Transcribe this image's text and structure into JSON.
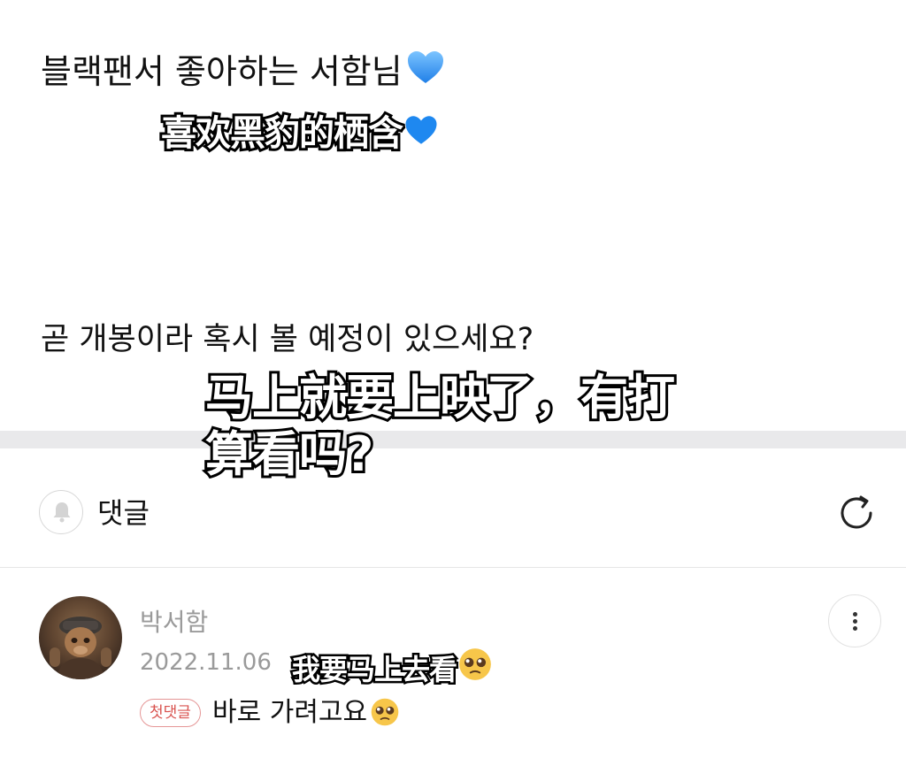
{
  "post": {
    "line1": "블랙팬서 좋아하는 서함님",
    "line2": "곧 개봉이라 혹시 볼 예정이 있으세요?"
  },
  "subtitles": {
    "line1": "喜欢黑豹的栖含",
    "line2a": "马上就要上映了，有打",
    "line2b": "算看吗?",
    "line3": "我要马上去看"
  },
  "comments_section": {
    "title": "댓글",
    "icons": {
      "bell": "bell-icon",
      "refresh": "refresh-icon"
    }
  },
  "comment": {
    "author": "박서함",
    "date": "2022.11.06",
    "badge": "첫댓글",
    "text": "바로 가려고요",
    "emoji": "pleading-face-emoji",
    "menu_icon": "more-vertical-icon"
  },
  "colors": {
    "heart": "#2f8cff",
    "divider": "#e9e9eb",
    "badge_border": "#e59696",
    "badge_text": "#d9534f",
    "meta_text": "#9a9a9a"
  }
}
